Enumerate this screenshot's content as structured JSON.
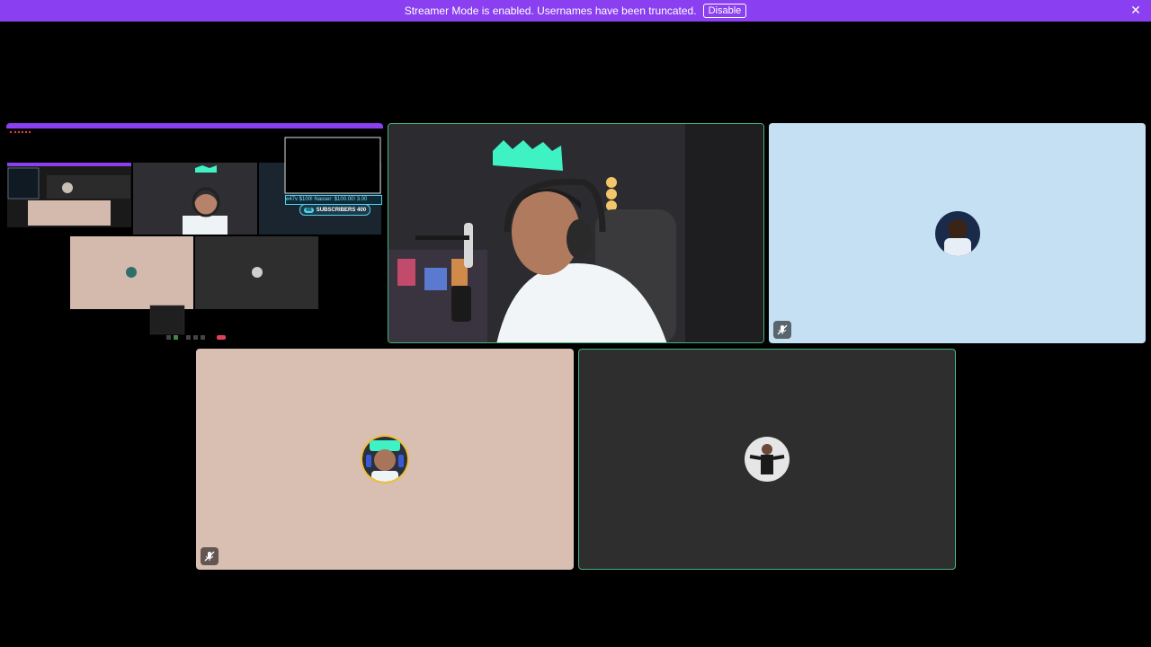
{
  "banner": {
    "message": "Streamer Mode is enabled. Usernames have been truncated.",
    "disable_label": "Disable",
    "close_icon": "close-icon",
    "color": "#8a3ff0"
  },
  "tiles": {
    "screen_share": {
      "ticker_text": "e47v $100! Nasser: $100.00! 3.00",
      "subscribers_label": "SUBSCRIBERS 400",
      "subscribers_count_badge": "46"
    },
    "camera_main": {
      "speaking": true
    },
    "user_blue": {
      "muted": true,
      "background": "#c5e0f2",
      "mute_icon": "mic-muted-icon"
    },
    "user_pink": {
      "muted": true,
      "background": "#d9bfb2",
      "mute_icon": "mic-muted-icon"
    },
    "user_dark": {
      "speaking": true,
      "background": "#2e2e2e"
    }
  },
  "colors": {
    "speaking_border": "#43b581",
    "accent_purple": "#8a3ff0",
    "background": "#000000"
  }
}
